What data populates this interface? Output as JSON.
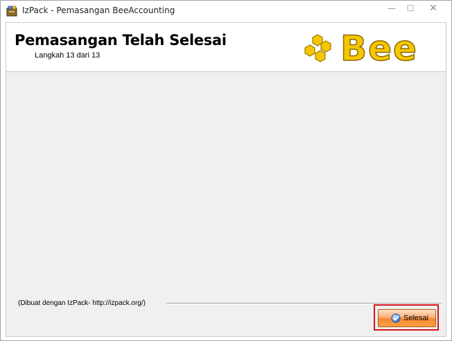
{
  "window": {
    "title": "IzPack - Pemasangan BeeAccounting",
    "minimize_glyph": "—",
    "maximize_glyph": "☐",
    "close_glyph": "✕"
  },
  "header": {
    "title": "Pemasangan Telah Selesai",
    "step": "Langkah 13 dari 13",
    "logo_text": "Bee"
  },
  "footer": {
    "credit": "(Dibuat dengan IzPack- http://izpack.org/)",
    "finish_label": "Selesai"
  },
  "colors": {
    "logo_yellow": "#f7c600",
    "logo_stroke": "#9a7a00",
    "highlight_red": "#d0141c",
    "button_orange": "#f68a2e"
  },
  "icons": {
    "app": "izpack-icon",
    "finish": "check-icon"
  }
}
